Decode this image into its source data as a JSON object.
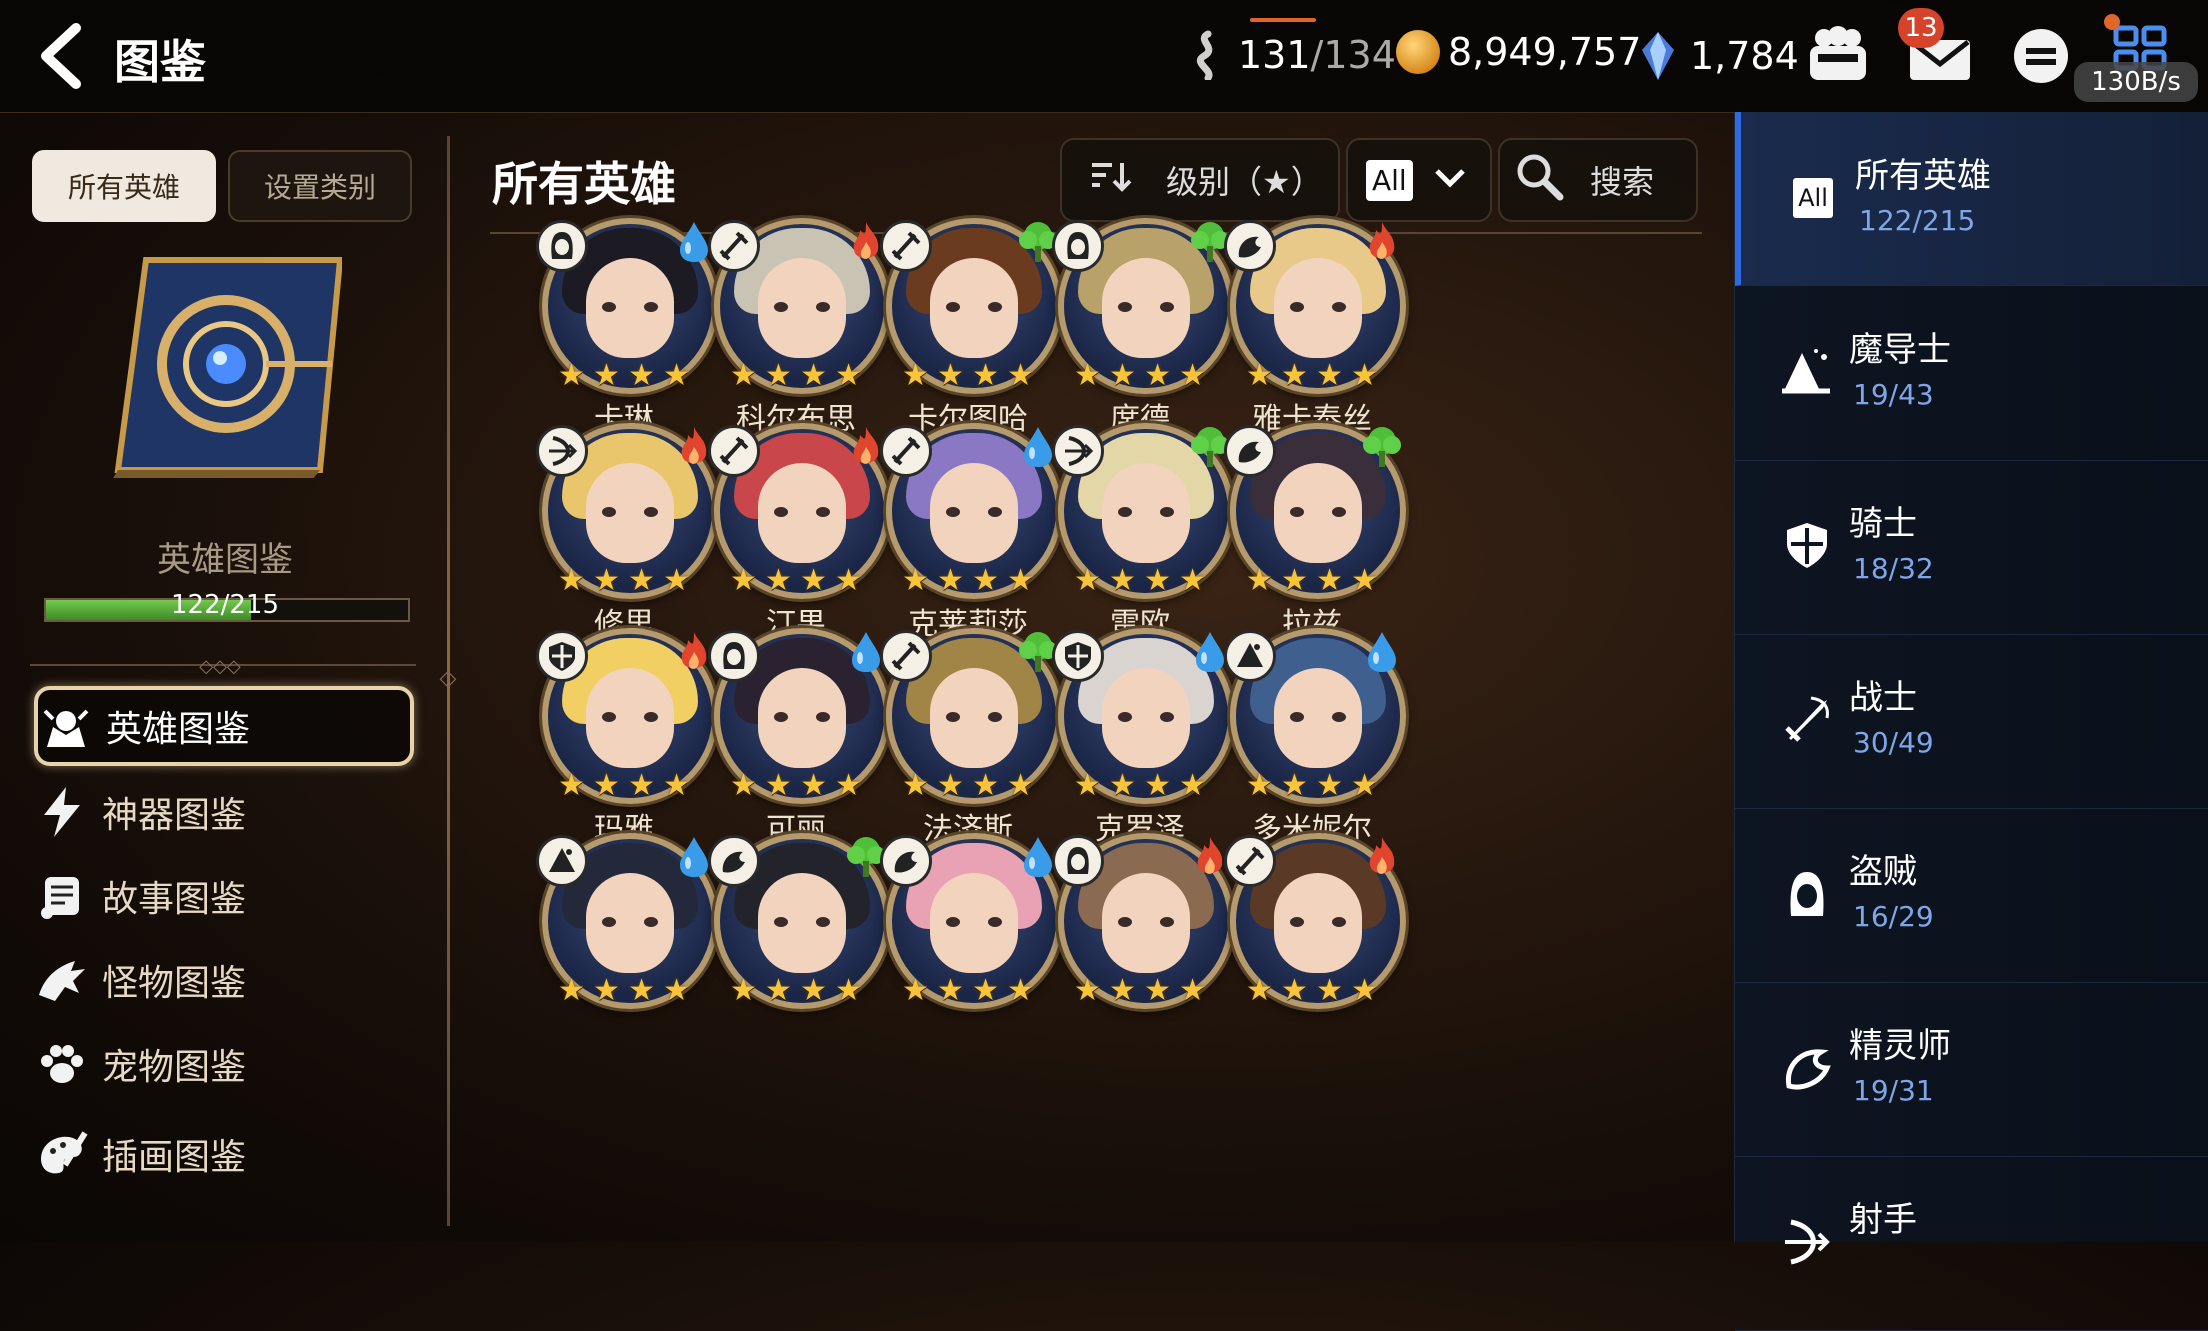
{
  "header": {
    "title": "图鉴",
    "stamina": {
      "current": "131",
      "max": "/134"
    },
    "gold": "8,949,757",
    "crystals": "1,784",
    "mail_badge": "13",
    "net_speed": "130B/s"
  },
  "left": {
    "tabs": [
      "所有英雄",
      "设置类别"
    ],
    "book_title": "英雄图鉴",
    "progress_text": "122/215",
    "progress_fraction": 0.567,
    "nav": [
      {
        "label": "英雄图鉴",
        "icon": "hero-codex-icon",
        "active": true
      },
      {
        "label": "神器图鉴",
        "icon": "lightning-icon"
      },
      {
        "label": "故事图鉴",
        "icon": "scroll-icon"
      },
      {
        "label": "怪物图鉴",
        "icon": "dragon-icon"
      },
      {
        "label": "宠物图鉴",
        "icon": "paw-icon"
      },
      {
        "label": "插画图鉴",
        "icon": "palette-icon"
      }
    ]
  },
  "main": {
    "heading": "所有英雄",
    "sort_label": "级别（★）",
    "filter_value": "All",
    "search_label": "搜索",
    "heroes": [
      {
        "name": "卡琳",
        "class": "thief",
        "element": "water",
        "hair": "#1c1a22"
      },
      {
        "name": "科尔布思",
        "class": "warrior",
        "element": "fire",
        "hair": "#c9c3b4"
      },
      {
        "name": "卡尔图哈",
        "class": "warrior",
        "element": "earth",
        "hair": "#6b3b20"
      },
      {
        "name": "席德",
        "class": "thief",
        "element": "earth",
        "hair": "#b9a16a"
      },
      {
        "name": "雅卡泰丝",
        "class": "spirit",
        "element": "fire",
        "hair": "#e8c98a"
      },
      {
        "name": "修里",
        "class": "archer",
        "element": "fire",
        "hair": "#e9c66b"
      },
      {
        "name": "汀果",
        "class": "warrior",
        "element": "fire",
        "hair": "#c9474a"
      },
      {
        "name": "克莱莉莎",
        "class": "warrior",
        "element": "water",
        "hair": "#8a78c4"
      },
      {
        "name": "雷欧",
        "class": "archer",
        "element": "earth",
        "hair": "#e3d7a8"
      },
      {
        "name": "拉兹",
        "class": "spirit",
        "element": "earth",
        "hair": "#3a2e3a"
      },
      {
        "name": "玛雅",
        "class": "knight",
        "element": "fire",
        "hair": "#f2cf63"
      },
      {
        "name": "可丽",
        "class": "thief",
        "element": "water",
        "hair": "#2a2230"
      },
      {
        "name": "法济斯",
        "class": "warrior",
        "element": "earth",
        "hair": "#a08546"
      },
      {
        "name": "克罗泽",
        "class": "knight",
        "element": "water",
        "hair": "#d9d4cf"
      },
      {
        "name": "多米妮尔",
        "class": "mage",
        "element": "water",
        "hair": "#3f5f8f"
      },
      {
        "name": "",
        "class": "mage",
        "element": "water",
        "hair": "#23283a"
      },
      {
        "name": "",
        "class": "spirit",
        "element": "earth",
        "hair": "#23232b"
      },
      {
        "name": "",
        "class": "spirit",
        "element": "water",
        "hair": "#e8a2b4"
      },
      {
        "name": "",
        "class": "thief",
        "element": "fire",
        "hair": "#8a6a50"
      },
      {
        "name": "",
        "class": "warrior",
        "element": "fire",
        "hair": "#5a3a26"
      }
    ]
  },
  "right": {
    "classes": [
      {
        "name": "所有英雄",
        "count": "122/215",
        "icon": "all-icon",
        "active": true
      },
      {
        "name": "魔导士",
        "count": "19/43",
        "icon": "wizard-hat-icon"
      },
      {
        "name": "骑士",
        "count": "18/32",
        "icon": "shield-icon"
      },
      {
        "name": "战士",
        "count": "30/49",
        "icon": "sword-icon"
      },
      {
        "name": "盗贼",
        "count": "16/29",
        "icon": "hood-icon"
      },
      {
        "name": "精灵师",
        "count": "19/31",
        "icon": "spirit-icon"
      },
      {
        "name": "射手",
        "count": "",
        "icon": "bow-icon"
      }
    ],
    "all_badge": "All"
  },
  "colors": {
    "accent_gold": "#d8b46a",
    "progress_green": "#56b33a",
    "count_blue": "#7fa7e8",
    "fire": "#e2452e",
    "water": "#3a9be8",
    "earth": "#4fbf3a"
  }
}
